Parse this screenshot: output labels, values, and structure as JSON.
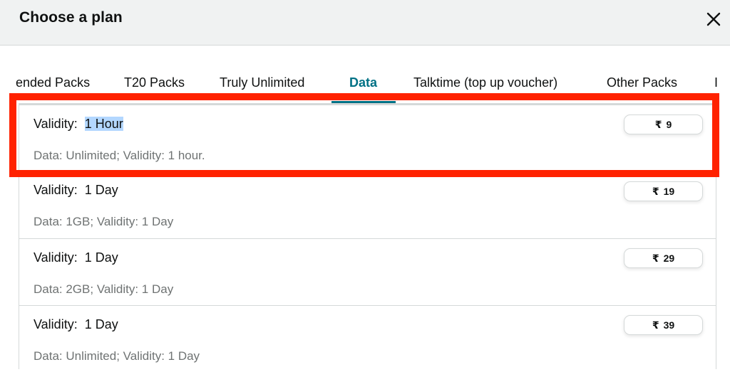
{
  "header": {
    "title": "Choose a plan",
    "close_icon": "close-icon"
  },
  "tabs": [
    {
      "label": "ended Packs",
      "active": false
    },
    {
      "label": "T20 Packs",
      "active": false
    },
    {
      "label": "Truly Unlimited",
      "active": false
    },
    {
      "label": "Data",
      "active": true
    },
    {
      "label": "Talktime (top up voucher)",
      "active": false
    },
    {
      "label": "Other Packs",
      "active": false
    },
    {
      "label": "I",
      "active": false
    }
  ],
  "plans": [
    {
      "validity_label": "Validity:",
      "validity_value": "1 Hour",
      "description": "Data: Unlimited; Validity: 1 hour.",
      "currency": "₹",
      "price": "9",
      "selected_text": true,
      "highlighted": true
    },
    {
      "validity_label": "Validity:",
      "validity_value": "1 Day",
      "description": "Data: 1GB; Validity: 1 Day",
      "currency": "₹",
      "price": "19"
    },
    {
      "validity_label": "Validity:",
      "validity_value": "1 Day",
      "description": "Data: 2GB; Validity: 1 Day",
      "currency": "₹",
      "price": "29"
    },
    {
      "validity_label": "Validity:",
      "validity_value": "1 Day",
      "description": "Data: Unlimited; Validity: 1 Day",
      "currency": "₹",
      "price": "39"
    }
  ],
  "colors": {
    "accent": "#007185",
    "highlight_box": "#ff2200",
    "text_selection": "#b3d7ff",
    "header_bg": "#f0f2f2",
    "muted_text": "#6f7373"
  }
}
